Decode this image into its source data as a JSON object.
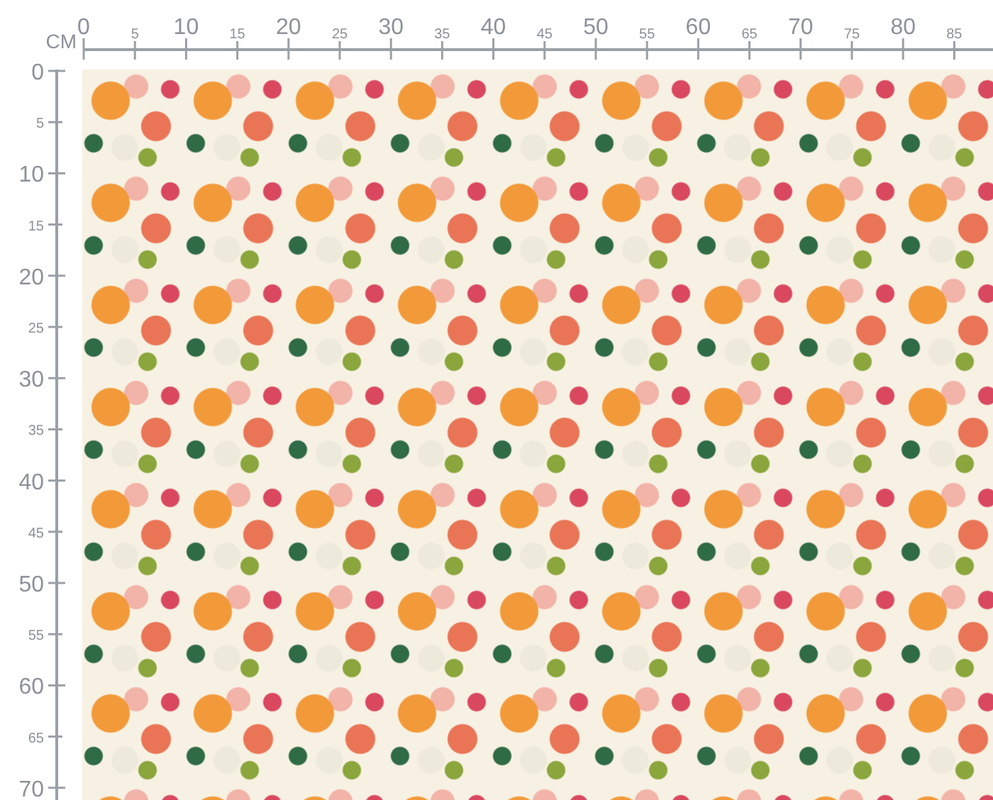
{
  "unit_label": "CM",
  "top_ruler": {
    "labels": [
      "0",
      "5",
      "10",
      "15",
      "20",
      "25",
      "30",
      "35",
      "40",
      "45",
      "50",
      "55",
      "60",
      "65",
      "70",
      "75",
      "80",
      "85"
    ]
  },
  "left_ruler": {
    "labels": [
      "0",
      "5",
      "10",
      "15",
      "20",
      "25",
      "30",
      "35",
      "40",
      "45",
      "50",
      "55",
      "60",
      "65",
      "70"
    ]
  }
}
